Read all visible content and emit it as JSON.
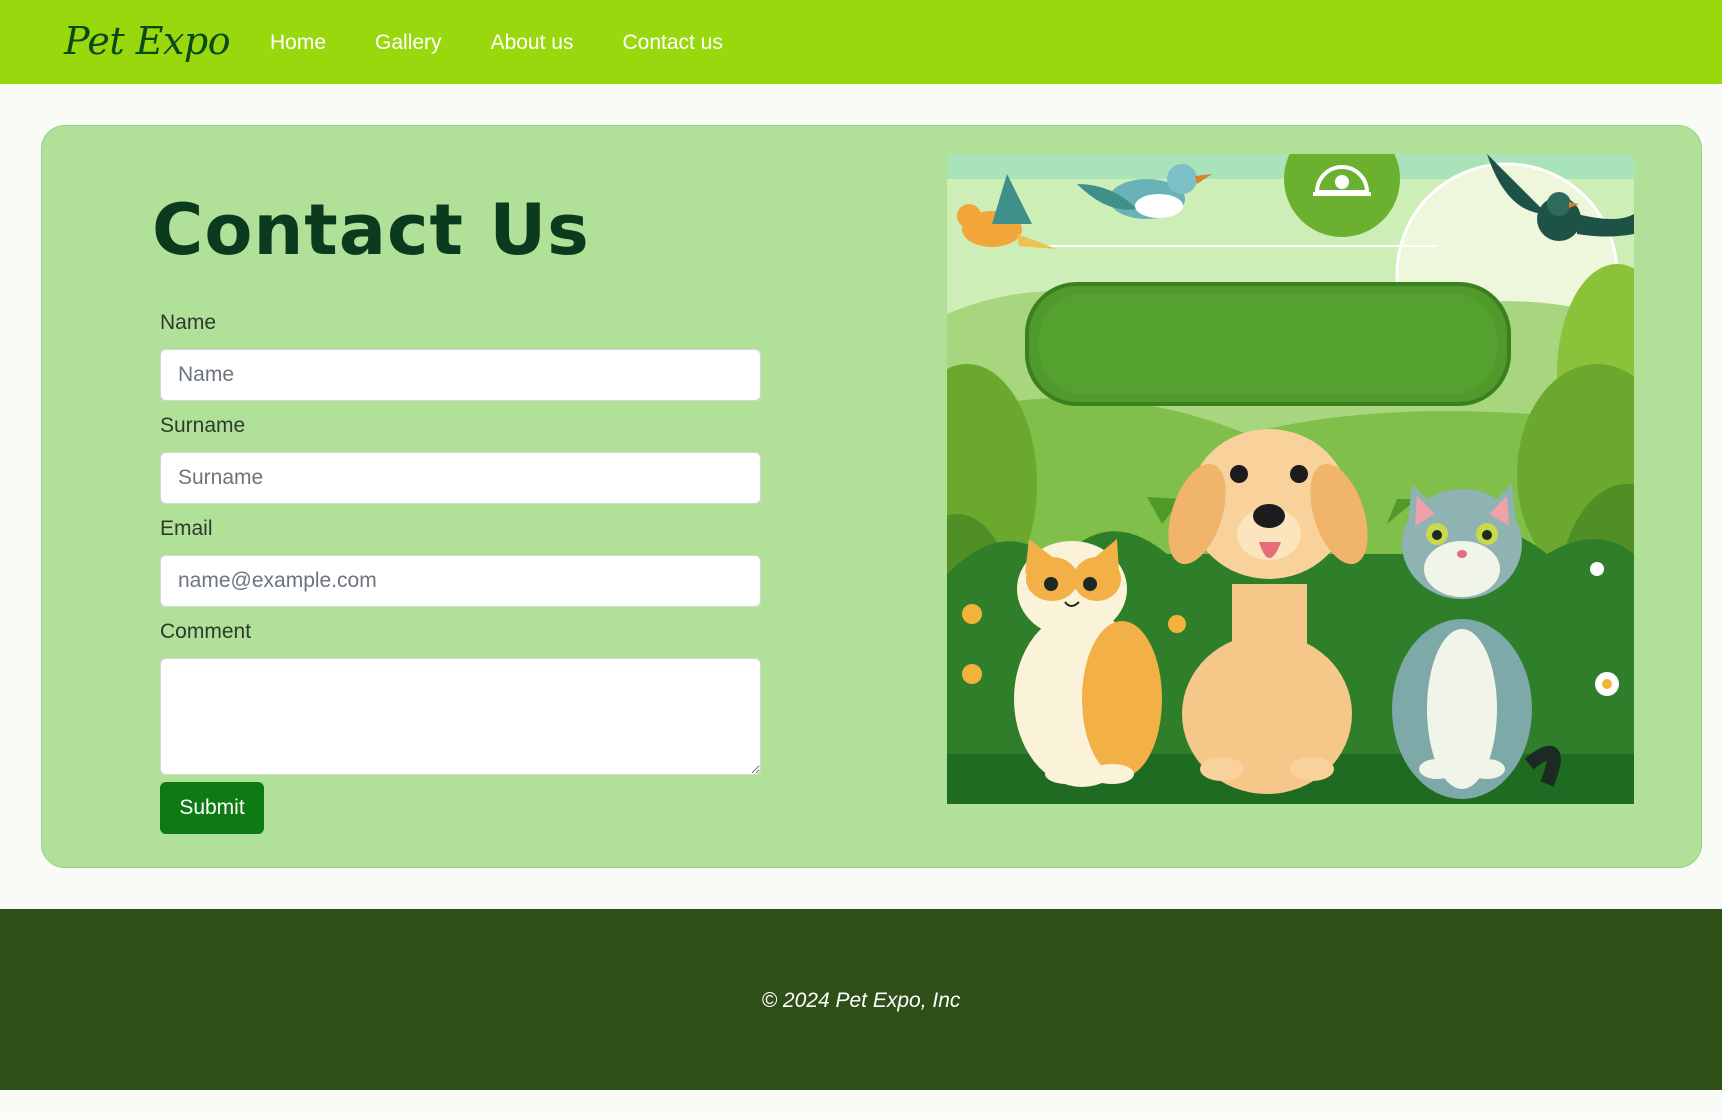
{
  "nav": {
    "brand": "Pet Expo",
    "links": [
      "Home",
      "Gallery",
      "About us",
      "Contact us"
    ]
  },
  "contact": {
    "title": "Contact Us",
    "fields": {
      "name": {
        "label": "Name",
        "placeholder": "Name"
      },
      "surname": {
        "label": "Surname",
        "placeholder": "Surname"
      },
      "email": {
        "label": "Email",
        "placeholder": "name@example.com"
      },
      "comment": {
        "label": "Comment"
      }
    },
    "submit_label": "Submit"
  },
  "footer": {
    "copyright": "© 2024 Pet Expo, Inc"
  },
  "colors": {
    "nav_bg": "#9ad80e",
    "card_bg": "#b1e199",
    "submit_bg": "#0e7a13",
    "footer_bg": "#2f4f19"
  }
}
